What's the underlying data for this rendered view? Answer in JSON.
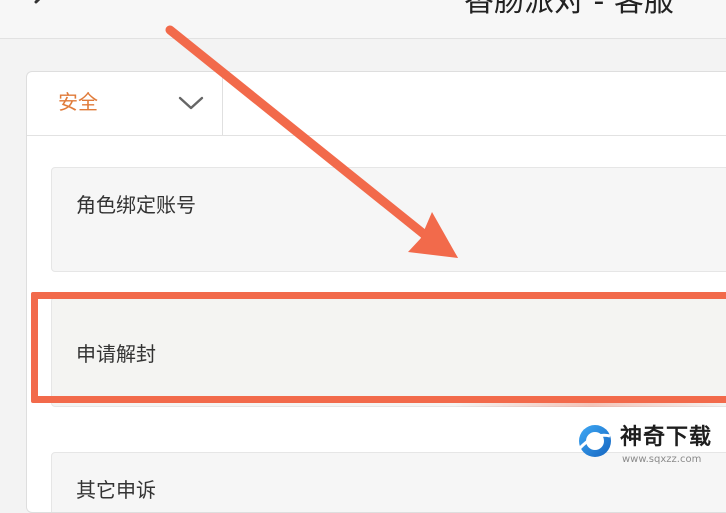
{
  "header": {
    "title": "香肠派对 - 客服",
    "back_icon": "chevron-left-icon"
  },
  "category": {
    "selected": "安全",
    "icon": "chevron-down-icon",
    "accent_color": "#e07b3a"
  },
  "options": [
    {
      "label": "角色绑定账号"
    },
    {
      "label": "申请解封"
    },
    {
      "label": "其它申诉"
    }
  ],
  "annotation": {
    "highlight_color": "#f26a4b",
    "highlighted_option": "申请解封"
  },
  "watermark": {
    "name": "神奇下载",
    "url": "www.sqxzz.com"
  }
}
